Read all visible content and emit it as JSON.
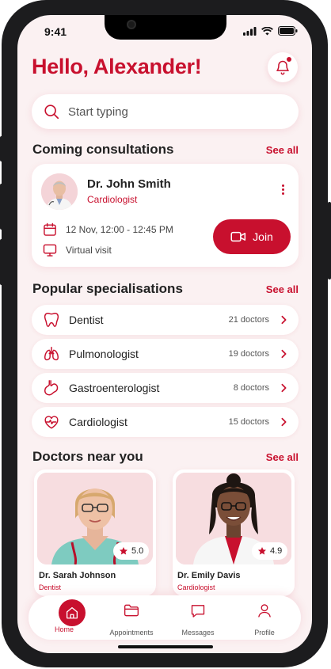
{
  "status_bar": {
    "time": "9:41"
  },
  "header": {
    "greeting": "Hello, Alexander!"
  },
  "search": {
    "placeholder": "Start typing"
  },
  "consultations": {
    "title": "Coming consultations",
    "see_all": "See all",
    "doctor_name": "Dr. John Smith",
    "doctor_specialty": "Cardiologist",
    "datetime": "12 Nov, 12:00 - 12:45 PM",
    "visit_type": "Virtual visit",
    "join_label": "Join"
  },
  "specialisations": {
    "title": "Popular specialisations",
    "see_all": "See all",
    "items": [
      {
        "name": "Dentist",
        "count": "21 doctors",
        "icon": "tooth-icon"
      },
      {
        "name": "Pulmonologist",
        "count": "19 doctors",
        "icon": "lungs-icon"
      },
      {
        "name": "Gastroenterologist",
        "count": "8 doctors",
        "icon": "stomach-icon"
      },
      {
        "name": "Cardiologist",
        "count": "15 doctors",
        "icon": "heart-pulse-icon"
      }
    ]
  },
  "nearby": {
    "title": "Doctors near you",
    "see_all": "See all",
    "doctors": [
      {
        "name": "Dr. Sarah Johnson",
        "specialty": "Dentist",
        "rating": "5.0"
      },
      {
        "name": "Dr. Emily Davis",
        "specialty": "Cardiologist",
        "rating": "4.9"
      }
    ]
  },
  "tabbar": {
    "tabs": [
      {
        "label": "Home",
        "icon": "home-icon",
        "active": true
      },
      {
        "label": "Appointments",
        "icon": "folder-icon",
        "active": false
      },
      {
        "label": "Messages",
        "icon": "chat-icon",
        "active": false
      },
      {
        "label": "Profile",
        "icon": "user-icon",
        "active": false
      }
    ]
  },
  "colors": {
    "accent": "#c8102e",
    "background": "#fbf1f2"
  }
}
